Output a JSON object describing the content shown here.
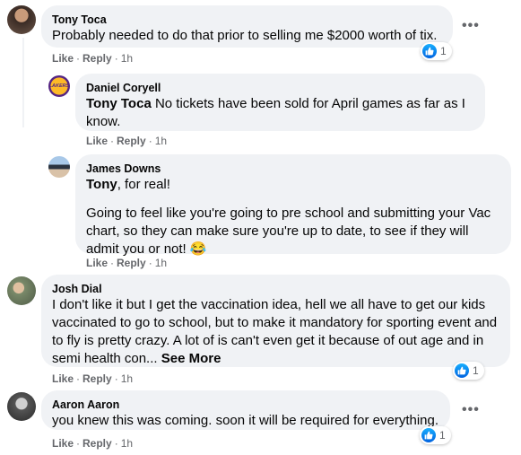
{
  "comments": [
    {
      "author": "Tony Toca",
      "text": "Probably needed to do that prior to selling me $2000 worth of tix.",
      "like": "Like",
      "reply": "Reply",
      "time": "1h",
      "reactions": "1"
    },
    {
      "author": "Daniel Coryell",
      "mention": "Tony Toca",
      "text": " No tickets have been sold for April games as far as I know.",
      "like": "Like",
      "reply": "Reply",
      "time": "1h"
    },
    {
      "author": "James Downs",
      "mention": "Tony",
      "text": ", for real!",
      "text2": "Going to feel like you're going to pre school and submitting your Vac chart, so they can make sure you're up to date, to see if they will admit you or not! ",
      "emoji": "😂",
      "like": "Like",
      "reply": "Reply",
      "time": "1h"
    },
    {
      "author": "Josh Dial",
      "text": "I don't like it but I get the vaccination idea, hell we all have to get our kids vaccinated to go to school, but to make it mandatory for sporting event and to fly is pretty crazy. A lot of is can't even get it because of out age and in semi health con... ",
      "see_more": "See More",
      "like": "Like",
      "reply": "Reply",
      "time": "1h",
      "reactions": "1"
    },
    {
      "author": "Aaron Aaron",
      "text": "you knew this was coming. soon it will be required for everything.",
      "like": "Like",
      "reply": "Reply",
      "time": "1h",
      "reactions": "1"
    }
  ],
  "avatar_logo_text": "LAKERS",
  "more_glyph": "•••",
  "dot": "·"
}
